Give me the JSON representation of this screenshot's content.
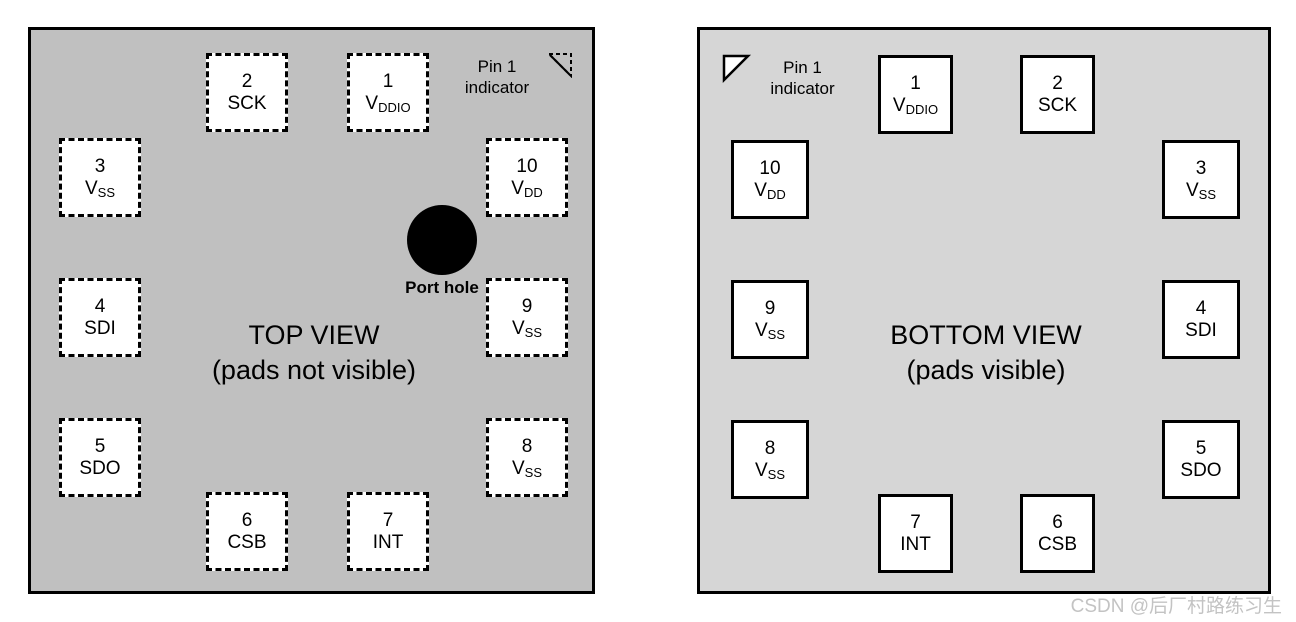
{
  "top_view": {
    "title_line1": "TOP VIEW",
    "title_line2": "(pads not visible)",
    "background_color": "#c0c0c0",
    "pin_border_style": "dashed",
    "port_hole_label": "Port hole",
    "indicator": {
      "line1": "Pin 1",
      "line2": "indicator",
      "glyph": "dashed-corner-triangle",
      "position": "top-right"
    },
    "pins": [
      {
        "number": "2",
        "label": "SCK",
        "sub": ""
      },
      {
        "number": "1",
        "label": "V",
        "sub": "DDIO"
      },
      {
        "number": "3",
        "label": "V",
        "sub": "SS"
      },
      {
        "number": "10",
        "label": "V",
        "sub": "DD"
      },
      {
        "number": "4",
        "label": "SDI",
        "sub": ""
      },
      {
        "number": "9",
        "label": "V",
        "sub": "SS"
      },
      {
        "number": "5",
        "label": "SDO",
        "sub": ""
      },
      {
        "number": "8",
        "label": "V",
        "sub": "SS"
      },
      {
        "number": "6",
        "label": "CSB",
        "sub": ""
      },
      {
        "number": "7",
        "label": "INT",
        "sub": ""
      }
    ]
  },
  "bottom_view": {
    "title_line1": "BOTTOM VIEW",
    "title_line2": "(pads visible)",
    "background_color": "#d6d6d6",
    "pin_border_style": "solid",
    "indicator": {
      "line1": "Pin 1",
      "line2": "indicator",
      "glyph": "outlined-triangle",
      "position": "top-left"
    },
    "pins": [
      {
        "number": "1",
        "label": "V",
        "sub": "DDIO"
      },
      {
        "number": "2",
        "label": "SCK",
        "sub": ""
      },
      {
        "number": "10",
        "label": "V",
        "sub": "DD"
      },
      {
        "number": "3",
        "label": "V",
        "sub": "SS"
      },
      {
        "number": "9",
        "label": "V",
        "sub": "SS"
      },
      {
        "number": "4",
        "label": "SDI",
        "sub": ""
      },
      {
        "number": "8",
        "label": "V",
        "sub": "SS"
      },
      {
        "number": "5",
        "label": "SDO",
        "sub": ""
      },
      {
        "number": "7",
        "label": "INT",
        "sub": ""
      },
      {
        "number": "6",
        "label": "CSB",
        "sub": ""
      }
    ]
  },
  "watermark": "CSDN @后厂村路练习生"
}
